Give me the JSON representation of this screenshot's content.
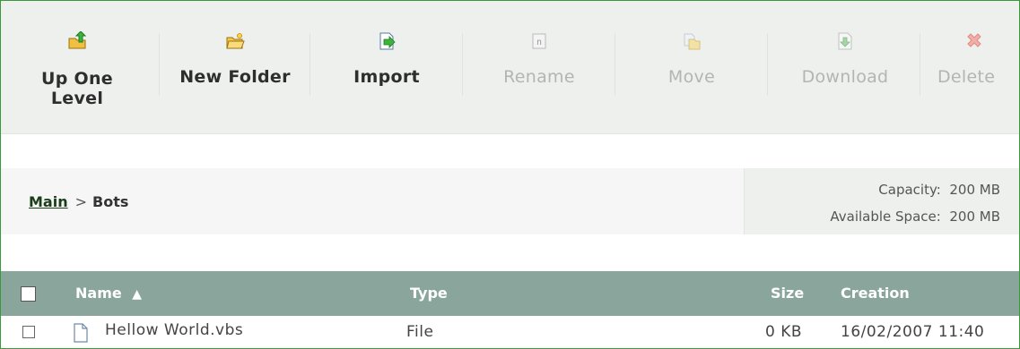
{
  "toolbar": {
    "items": [
      {
        "label_line1": "Up One",
        "label_line2": "Level",
        "icon": "up-folder-icon",
        "enabled": true
      },
      {
        "label": "New Folder",
        "icon": "new-folder-icon",
        "enabled": true
      },
      {
        "label": "Import",
        "icon": "import-icon",
        "enabled": true
      },
      {
        "label": "Rename",
        "icon": "rename-icon",
        "enabled": false
      },
      {
        "label": "Move",
        "icon": "move-icon",
        "enabled": false
      },
      {
        "label": "Download",
        "icon": "download-icon",
        "enabled": false
      },
      {
        "label": "Delete",
        "icon": "delete-icon",
        "enabled": false
      }
    ]
  },
  "breadcrumb": {
    "root": "Main",
    "separator": ">",
    "current": "Bots"
  },
  "capacity": {
    "capacity_label": "Capacity:",
    "capacity_value": "200 MB",
    "available_label": "Available Space:",
    "available_value": "200 MB"
  },
  "table": {
    "columns": {
      "name": "Name",
      "sort_indicator": "▲",
      "type": "Type",
      "size": "Size",
      "creation": "Creation"
    },
    "rows": [
      {
        "name": "Hellow World.vbs",
        "type": "File",
        "size": "0 KB",
        "creation": "16/02/2007 11:40"
      }
    ]
  },
  "colors": {
    "frame_border": "#3a9a3a",
    "toolbar_bg": "#eef0ee",
    "header_bg": "#8aa69c",
    "disabled_text": "#b3b5b3"
  }
}
